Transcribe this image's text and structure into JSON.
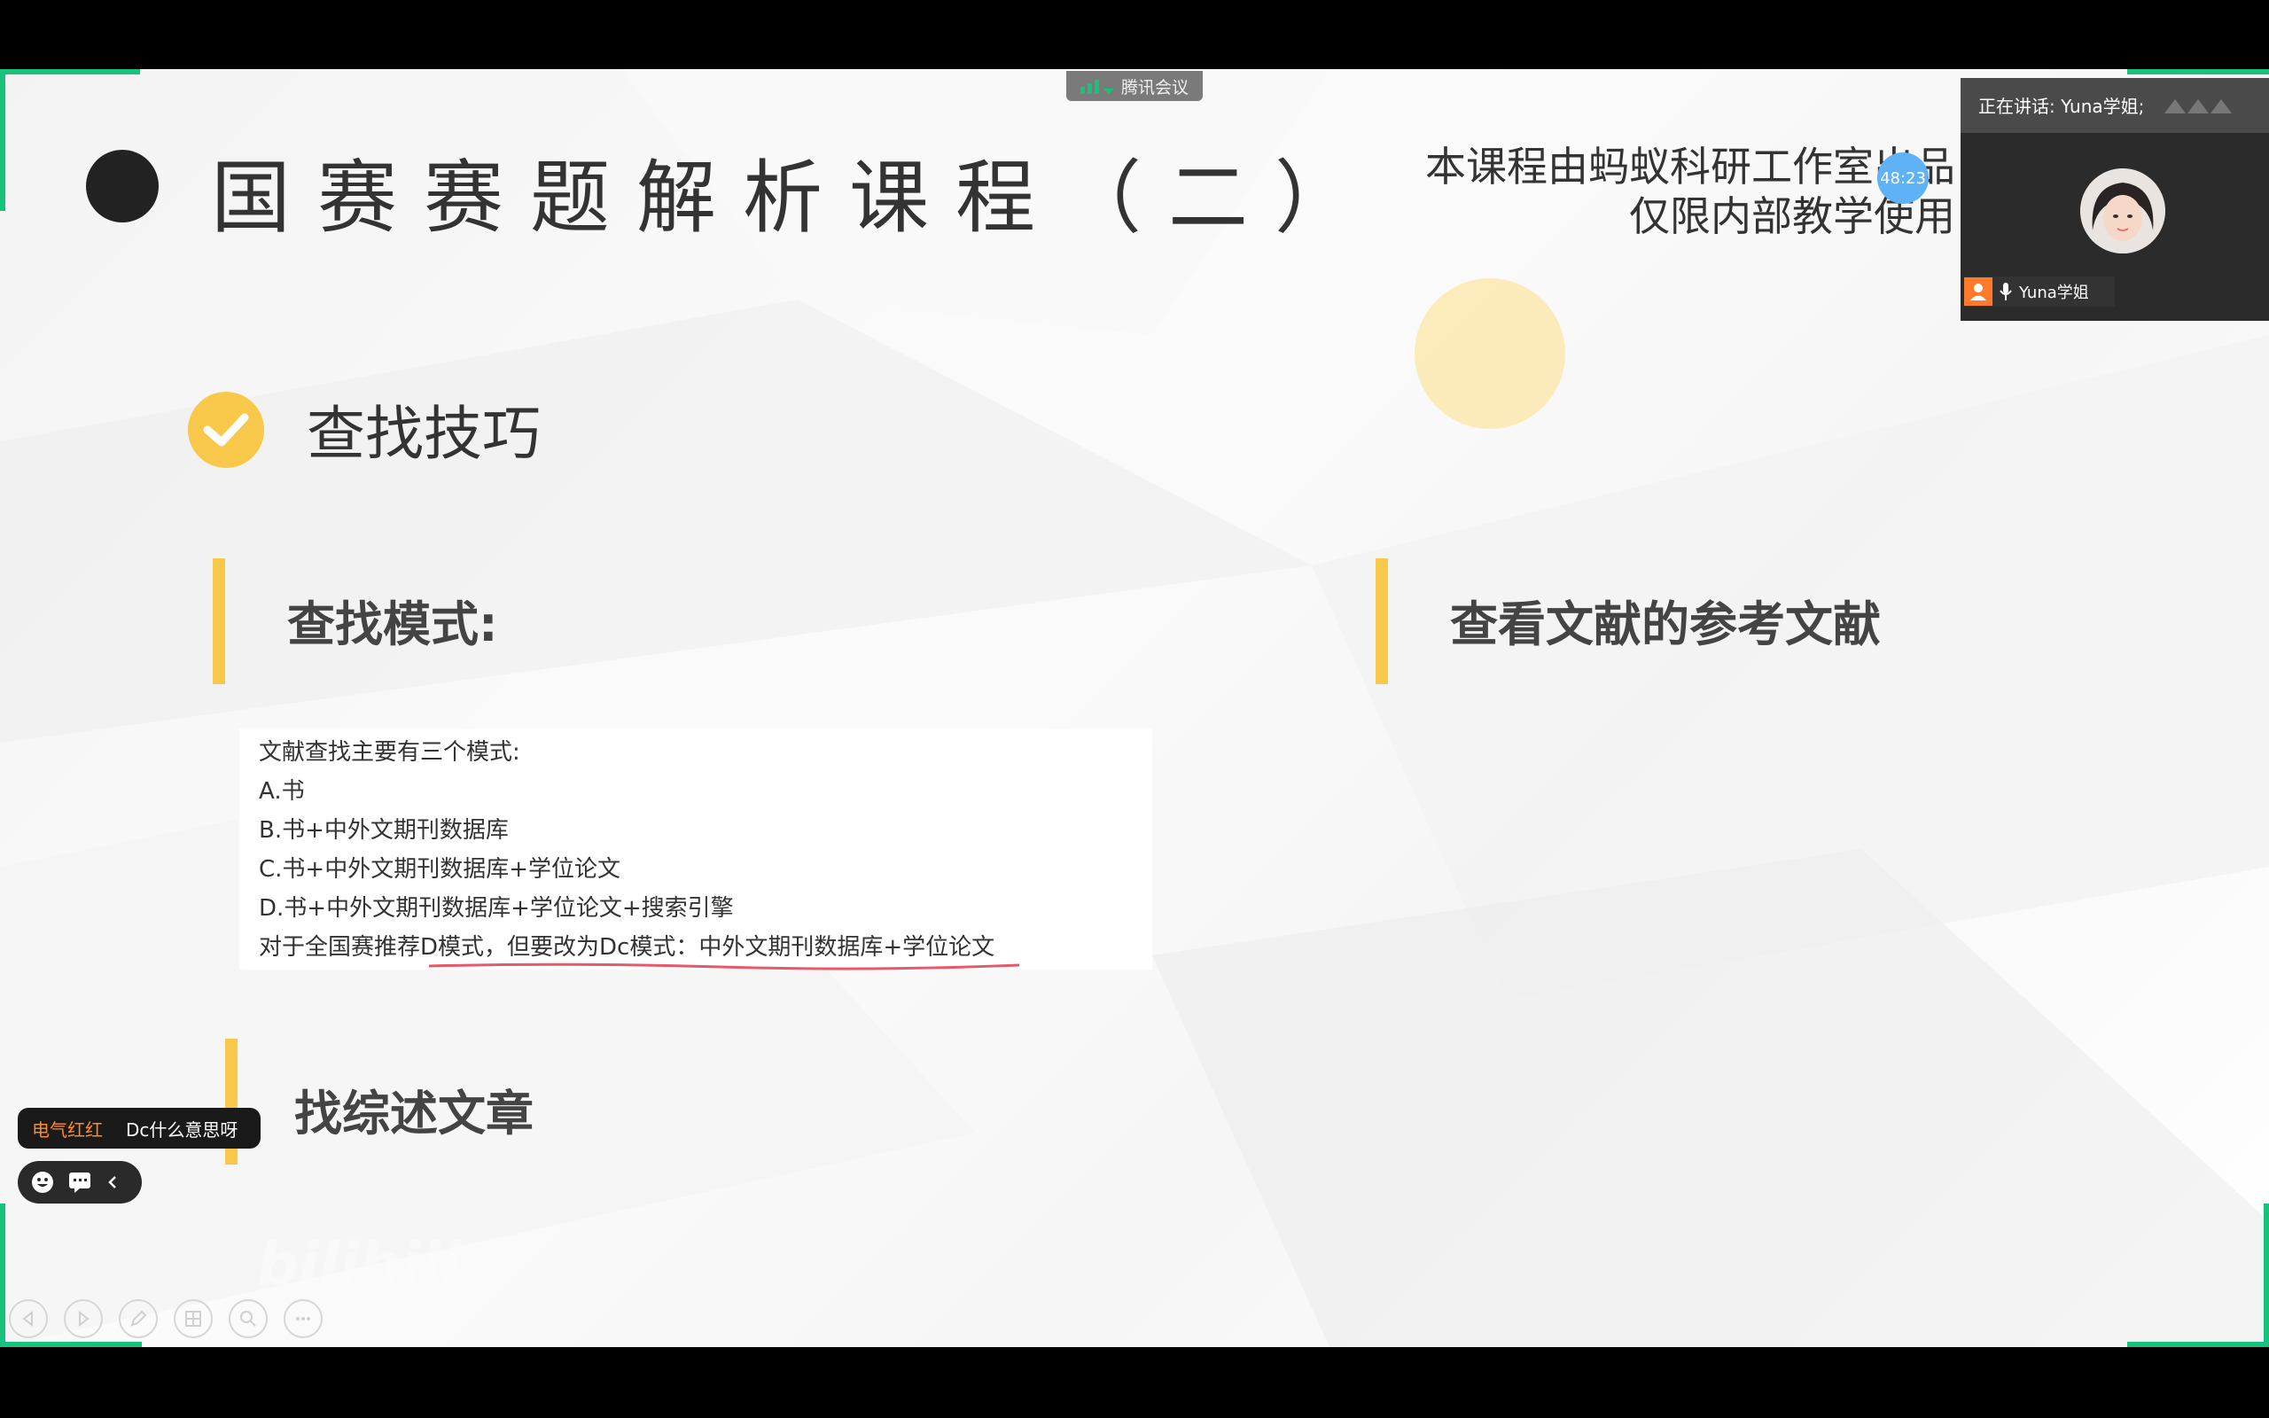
{
  "meeting": {
    "app_label": "腾讯会议",
    "speaking_label": "正在讲话: Yuna学姐;",
    "participant_name": "Yuna学姐",
    "timer": "48:23",
    "accent_color": "#19c27b"
  },
  "slide": {
    "title": "国赛赛题解析课程（二）",
    "note_line1": "本课程由蚂蚁科研工作室出品",
    "note_line2": "仅限内部教学使用",
    "section_heading": "查找技巧",
    "sub1": "查找模式:",
    "sub2": "查看文献的参考文献",
    "sub3": "找综述文章",
    "text_lines": [
      "文献查找主要有三个模式:",
      "A.书",
      "B.书+中外文期刊数据库",
      "C.书+中外文期刊数据库+学位论文",
      "D.书+中外文期刊数据库+学位论文+搜索引擎",
      "对于全国赛推荐D模式，但要改为Dc模式：中外文期刊数据库+学位论文"
    ],
    "accent_yellow": "#f8c84a"
  },
  "danmaku": {
    "user": "电气红红",
    "message": "Dc什么意思呀"
  },
  "watermark": "bilibili"
}
